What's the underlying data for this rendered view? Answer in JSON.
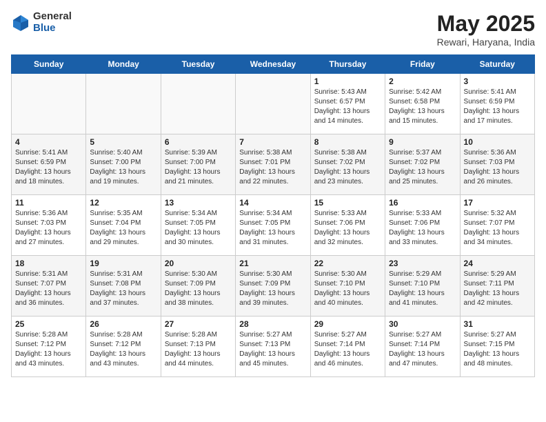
{
  "logo": {
    "general": "General",
    "blue": "Blue"
  },
  "title": "May 2025",
  "subtitle": "Rewari, Haryana, India",
  "days_of_week": [
    "Sunday",
    "Monday",
    "Tuesday",
    "Wednesday",
    "Thursday",
    "Friday",
    "Saturday"
  ],
  "weeks": [
    [
      {
        "day": "",
        "info": ""
      },
      {
        "day": "",
        "info": ""
      },
      {
        "day": "",
        "info": ""
      },
      {
        "day": "",
        "info": ""
      },
      {
        "day": "1",
        "info": "Sunrise: 5:43 AM\nSunset: 6:57 PM\nDaylight: 13 hours\nand 14 minutes."
      },
      {
        "day": "2",
        "info": "Sunrise: 5:42 AM\nSunset: 6:58 PM\nDaylight: 13 hours\nand 15 minutes."
      },
      {
        "day": "3",
        "info": "Sunrise: 5:41 AM\nSunset: 6:59 PM\nDaylight: 13 hours\nand 17 minutes."
      }
    ],
    [
      {
        "day": "4",
        "info": "Sunrise: 5:41 AM\nSunset: 6:59 PM\nDaylight: 13 hours\nand 18 minutes."
      },
      {
        "day": "5",
        "info": "Sunrise: 5:40 AM\nSunset: 7:00 PM\nDaylight: 13 hours\nand 19 minutes."
      },
      {
        "day": "6",
        "info": "Sunrise: 5:39 AM\nSunset: 7:00 PM\nDaylight: 13 hours\nand 21 minutes."
      },
      {
        "day": "7",
        "info": "Sunrise: 5:38 AM\nSunset: 7:01 PM\nDaylight: 13 hours\nand 22 minutes."
      },
      {
        "day": "8",
        "info": "Sunrise: 5:38 AM\nSunset: 7:02 PM\nDaylight: 13 hours\nand 23 minutes."
      },
      {
        "day": "9",
        "info": "Sunrise: 5:37 AM\nSunset: 7:02 PM\nDaylight: 13 hours\nand 25 minutes."
      },
      {
        "day": "10",
        "info": "Sunrise: 5:36 AM\nSunset: 7:03 PM\nDaylight: 13 hours\nand 26 minutes."
      }
    ],
    [
      {
        "day": "11",
        "info": "Sunrise: 5:36 AM\nSunset: 7:03 PM\nDaylight: 13 hours\nand 27 minutes."
      },
      {
        "day": "12",
        "info": "Sunrise: 5:35 AM\nSunset: 7:04 PM\nDaylight: 13 hours\nand 29 minutes."
      },
      {
        "day": "13",
        "info": "Sunrise: 5:34 AM\nSunset: 7:05 PM\nDaylight: 13 hours\nand 30 minutes."
      },
      {
        "day": "14",
        "info": "Sunrise: 5:34 AM\nSunset: 7:05 PM\nDaylight: 13 hours\nand 31 minutes."
      },
      {
        "day": "15",
        "info": "Sunrise: 5:33 AM\nSunset: 7:06 PM\nDaylight: 13 hours\nand 32 minutes."
      },
      {
        "day": "16",
        "info": "Sunrise: 5:33 AM\nSunset: 7:06 PM\nDaylight: 13 hours\nand 33 minutes."
      },
      {
        "day": "17",
        "info": "Sunrise: 5:32 AM\nSunset: 7:07 PM\nDaylight: 13 hours\nand 34 minutes."
      }
    ],
    [
      {
        "day": "18",
        "info": "Sunrise: 5:31 AM\nSunset: 7:07 PM\nDaylight: 13 hours\nand 36 minutes."
      },
      {
        "day": "19",
        "info": "Sunrise: 5:31 AM\nSunset: 7:08 PM\nDaylight: 13 hours\nand 37 minutes."
      },
      {
        "day": "20",
        "info": "Sunrise: 5:30 AM\nSunset: 7:09 PM\nDaylight: 13 hours\nand 38 minutes."
      },
      {
        "day": "21",
        "info": "Sunrise: 5:30 AM\nSunset: 7:09 PM\nDaylight: 13 hours\nand 39 minutes."
      },
      {
        "day": "22",
        "info": "Sunrise: 5:30 AM\nSunset: 7:10 PM\nDaylight: 13 hours\nand 40 minutes."
      },
      {
        "day": "23",
        "info": "Sunrise: 5:29 AM\nSunset: 7:10 PM\nDaylight: 13 hours\nand 41 minutes."
      },
      {
        "day": "24",
        "info": "Sunrise: 5:29 AM\nSunset: 7:11 PM\nDaylight: 13 hours\nand 42 minutes."
      }
    ],
    [
      {
        "day": "25",
        "info": "Sunrise: 5:28 AM\nSunset: 7:12 PM\nDaylight: 13 hours\nand 43 minutes."
      },
      {
        "day": "26",
        "info": "Sunrise: 5:28 AM\nSunset: 7:12 PM\nDaylight: 13 hours\nand 43 minutes."
      },
      {
        "day": "27",
        "info": "Sunrise: 5:28 AM\nSunset: 7:13 PM\nDaylight: 13 hours\nand 44 minutes."
      },
      {
        "day": "28",
        "info": "Sunrise: 5:27 AM\nSunset: 7:13 PM\nDaylight: 13 hours\nand 45 minutes."
      },
      {
        "day": "29",
        "info": "Sunrise: 5:27 AM\nSunset: 7:14 PM\nDaylight: 13 hours\nand 46 minutes."
      },
      {
        "day": "30",
        "info": "Sunrise: 5:27 AM\nSunset: 7:14 PM\nDaylight: 13 hours\nand 47 minutes."
      },
      {
        "day": "31",
        "info": "Sunrise: 5:27 AM\nSunset: 7:15 PM\nDaylight: 13 hours\nand 48 minutes."
      }
    ]
  ]
}
